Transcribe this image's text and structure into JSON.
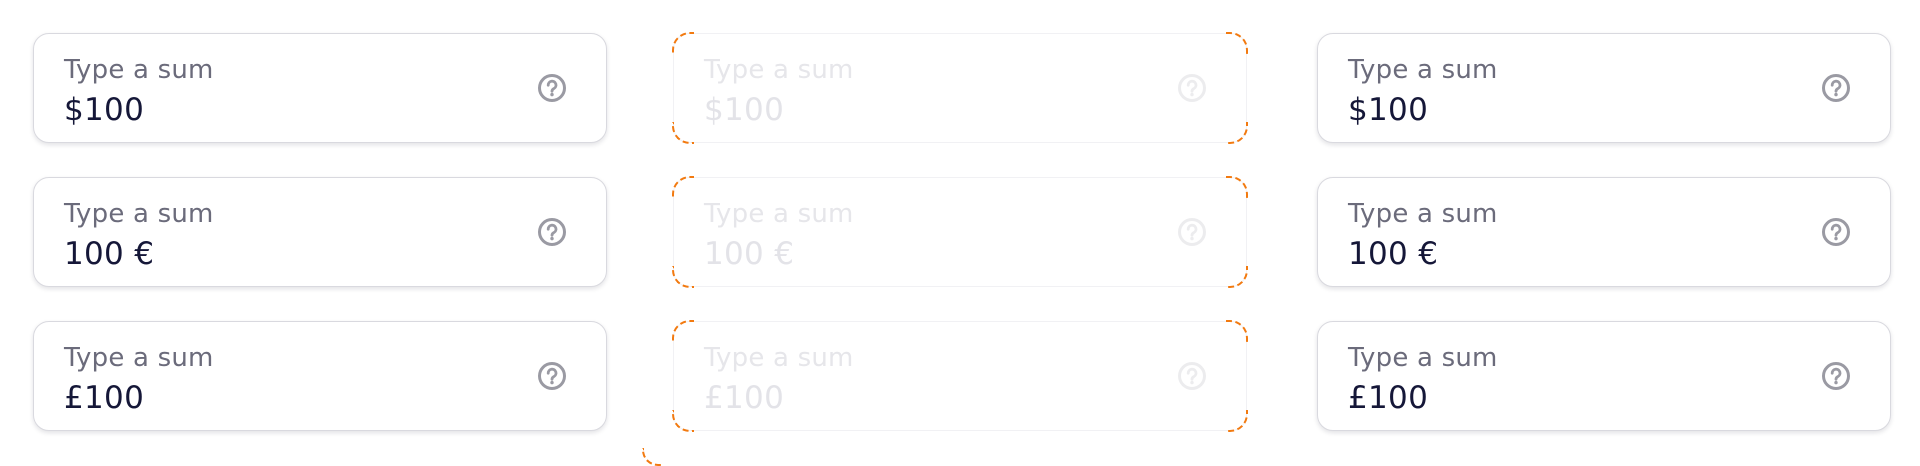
{
  "columns": [
    {
      "state": "default",
      "fields": [
        {
          "label": "Type a sum",
          "value": "$100",
          "icon": "help-circle-icon"
        },
        {
          "label": "Type a sum",
          "value": "100 €",
          "icon": "help-circle-icon"
        },
        {
          "label": "Type a sum",
          "value": "£100",
          "icon": "help-circle-icon"
        }
      ]
    },
    {
      "state": "disabled",
      "fields": [
        {
          "label": "Type a sum",
          "value": "$100",
          "icon": "help-circle-icon"
        },
        {
          "label": "Type a sum",
          "value": "100 €",
          "icon": "help-circle-icon"
        },
        {
          "label": "Type a sum",
          "value": "£100",
          "icon": "help-circle-icon"
        }
      ]
    },
    {
      "state": "default",
      "fields": [
        {
          "label": "Type a sum",
          "value": "$100",
          "icon": "help-circle-icon"
        },
        {
          "label": "Type a sum",
          "value": "100 €",
          "icon": "help-circle-icon"
        },
        {
          "label": "Type a sum",
          "value": "£100",
          "icon": "help-circle-icon"
        }
      ]
    }
  ],
  "colors": {
    "label": "#6b6b7b",
    "value": "#151738",
    "icon": "#9a9aa3",
    "border": "#d9d9df",
    "disabled_text": "#e3e3e8",
    "focus_outline": "#f27a10"
  }
}
